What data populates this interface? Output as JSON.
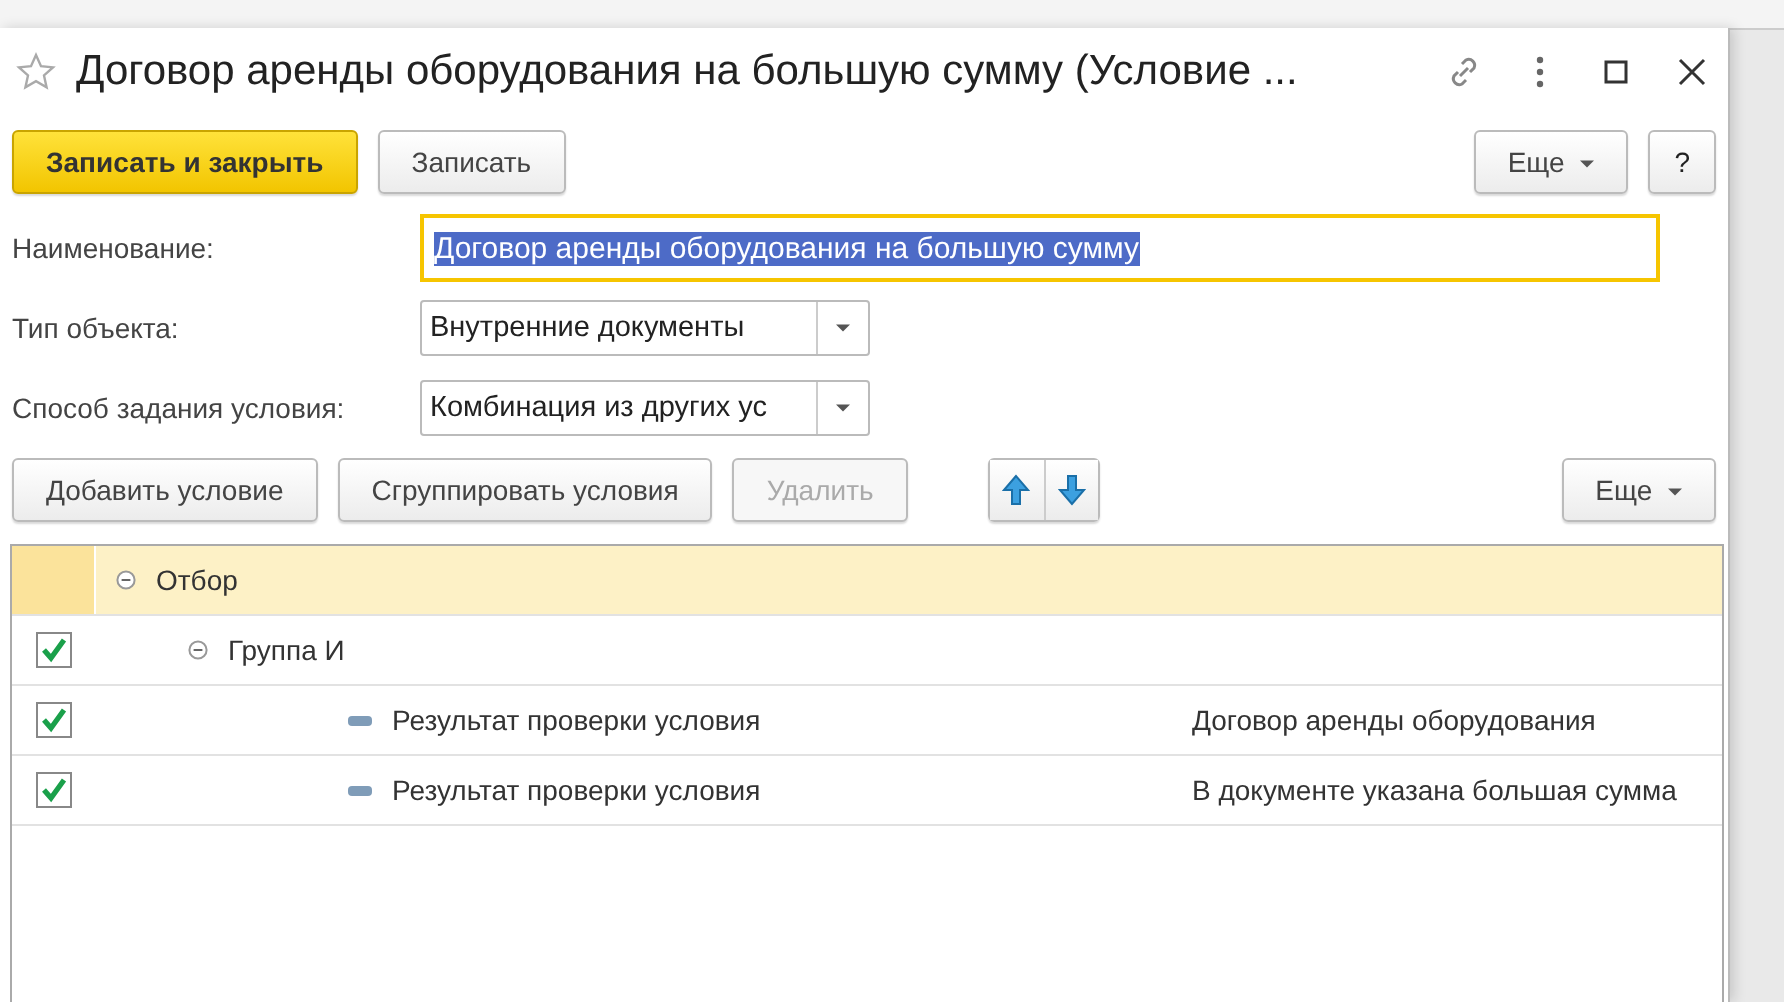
{
  "window": {
    "title": "Договор аренды оборудования на большую сумму (Условие ..."
  },
  "toolbar": {
    "buttons": [
      {
        "label": "Записать и закрыть",
        "kind": "primary"
      },
      {
        "label": "Записать",
        "kind": "normal"
      }
    ],
    "more": "Еще",
    "help": "?"
  },
  "fields": [
    {
      "label": "Наименование:",
      "value": "Договор аренды оборудования на большую сумму",
      "kind": "text",
      "focused": true
    },
    {
      "label": "Тип объекта:",
      "value": "Внутренние документы",
      "kind": "select"
    },
    {
      "label": "Способ задания условия:",
      "value": "Комбинация из других ус",
      "kind": "select"
    }
  ],
  "conditions_toolbar": {
    "buttons": [
      {
        "label": "Добавить условие",
        "disabled": false
      },
      {
        "label": "Сгруппировать условия",
        "disabled": false
      },
      {
        "label": "Удалить",
        "disabled": true
      }
    ],
    "more": "Еще"
  },
  "tree": [
    {
      "label": "Отбор",
      "kind": "root",
      "selected": true,
      "expanded": true,
      "children": [
        {
          "label": "Группа И",
          "kind": "group",
          "checked": true,
          "selected": false,
          "expanded": true,
          "children": [
            {
              "label": "Результат проверки условия",
              "value": "Договор аренды оборудования",
              "kind": "condition",
              "checked": true,
              "selected": false
            },
            {
              "label": "Результат проверки условия",
              "value": "В документе указана большая сумма",
              "kind": "condition",
              "checked": true,
              "selected": false
            }
          ]
        }
      ]
    }
  ]
}
